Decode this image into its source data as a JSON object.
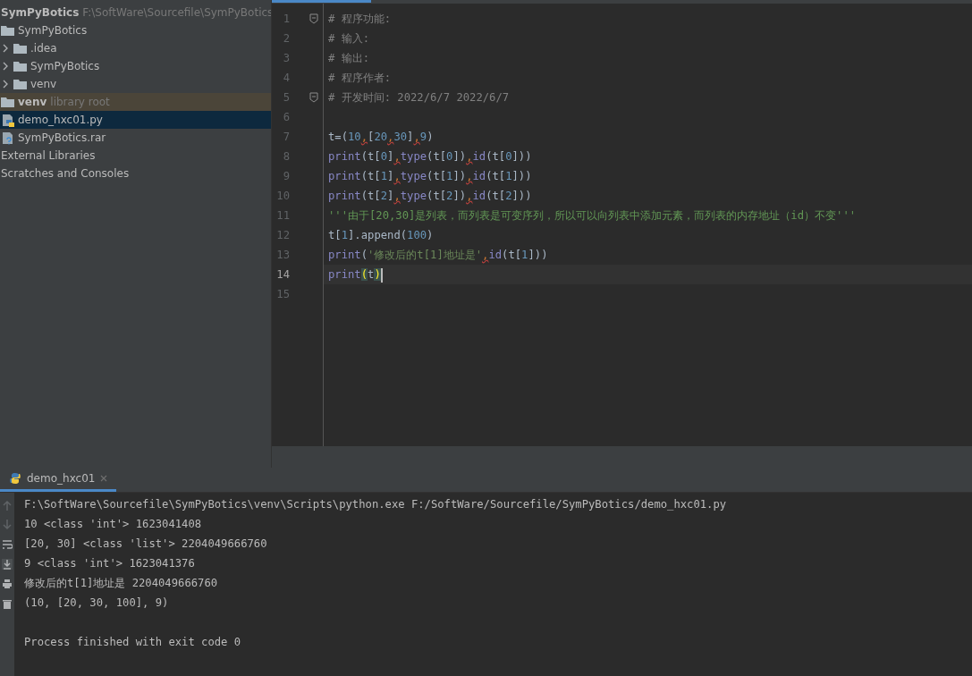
{
  "project": {
    "name": "SymPyBotics",
    "path": "F:\\SoftWare\\Sourcefile\\SymPyBotics"
  },
  "tree": [
    {
      "label": "SymPyBotics",
      "kind": "folder",
      "chevron": false,
      "selected": false,
      "highlighted": false
    },
    {
      "label": ".idea",
      "kind": "folder",
      "chevron": true,
      "selected": false,
      "highlighted": false
    },
    {
      "label": "SymPyBotics",
      "kind": "folder",
      "chevron": true,
      "selected": false,
      "highlighted": false
    },
    {
      "label": "venv",
      "kind": "folder",
      "chevron": true,
      "selected": false,
      "highlighted": false
    },
    {
      "label": "venv",
      "suffix": "library root",
      "kind": "folder",
      "chevron": false,
      "selected": false,
      "highlighted": true
    },
    {
      "label": "demo_hxc01.py",
      "kind": "python",
      "chevron": false,
      "selected": true,
      "highlighted": false
    },
    {
      "label": "SymPyBotics.rar",
      "kind": "unknown",
      "chevron": false,
      "selected": false,
      "highlighted": false
    },
    {
      "label": "External Libraries",
      "kind": "none",
      "chevron": false,
      "selected": false,
      "highlighted": false
    },
    {
      "label": "Scratches and Consoles",
      "kind": "none",
      "chevron": false,
      "selected": false,
      "highlighted": false
    }
  ],
  "editor": {
    "lines": [
      {
        "number": "1",
        "fold": true,
        "current": false,
        "segments": [
          {
            "text": "# 程序功能:",
            "kind": "comment"
          }
        ]
      },
      {
        "number": "2",
        "current": false,
        "segments": [
          {
            "text": "# 输入:",
            "kind": "comment"
          }
        ]
      },
      {
        "number": "3",
        "current": false,
        "segments": [
          {
            "text": "# 输出:",
            "kind": "comment"
          }
        ]
      },
      {
        "number": "4",
        "current": false,
        "segments": [
          {
            "text": "# 程序作者:",
            "kind": "comment"
          }
        ]
      },
      {
        "number": "5",
        "fold": true,
        "current": false,
        "segments": [
          {
            "text": "# 开发时间:  2022/6/7 2022/6/7",
            "kind": "comment"
          }
        ]
      },
      {
        "number": "6",
        "current": false
      },
      {
        "number": "7",
        "current": false,
        "segments": [
          {
            "text": "t=(",
            "kind": "plain"
          },
          {
            "text": "10",
            "kind": "number"
          },
          {
            "text": ",",
            "kind": "warn"
          },
          {
            "text": "[",
            "kind": "plain"
          },
          {
            "text": "20",
            "kind": "number"
          },
          {
            "text": ",",
            "kind": "warn"
          },
          {
            "text": "30",
            "kind": "number"
          },
          {
            "text": "]",
            "kind": "plain"
          },
          {
            "text": ",",
            "kind": "warn"
          },
          {
            "text": "9",
            "kind": "number"
          },
          {
            "text": ")",
            "kind": "plain"
          }
        ]
      },
      {
        "number": "8",
        "current": false,
        "segments": [
          {
            "text": "print",
            "kind": "builtin"
          },
          {
            "text": "(t[",
            "kind": "plain"
          },
          {
            "text": "0",
            "kind": "number"
          },
          {
            "text": "]",
            "kind": "plain"
          },
          {
            "text": ",",
            "kind": "warn"
          },
          {
            "text": "type",
            "kind": "builtin"
          },
          {
            "text": "(t[",
            "kind": "plain"
          },
          {
            "text": "0",
            "kind": "number"
          },
          {
            "text": "])",
            "kind": "plain"
          },
          {
            "text": ",",
            "kind": "warn"
          },
          {
            "text": "id",
            "kind": "builtin"
          },
          {
            "text": "(t[",
            "kind": "plain"
          },
          {
            "text": "0",
            "kind": "number"
          },
          {
            "text": "]))",
            "kind": "plain"
          }
        ]
      },
      {
        "number": "9",
        "current": false,
        "segments": [
          {
            "text": "print",
            "kind": "builtin"
          },
          {
            "text": "(t[",
            "kind": "plain"
          },
          {
            "text": "1",
            "kind": "number"
          },
          {
            "text": "]",
            "kind": "plain"
          },
          {
            "text": ",",
            "kind": "warn"
          },
          {
            "text": "type",
            "kind": "builtin"
          },
          {
            "text": "(t[",
            "kind": "plain"
          },
          {
            "text": "1",
            "kind": "number"
          },
          {
            "text": "])",
            "kind": "plain"
          },
          {
            "text": ",",
            "kind": "warn"
          },
          {
            "text": "id",
            "kind": "builtin"
          },
          {
            "text": "(t[",
            "kind": "plain"
          },
          {
            "text": "1",
            "kind": "number"
          },
          {
            "text": "]))",
            "kind": "plain"
          }
        ]
      },
      {
        "number": "10",
        "current": false,
        "segments": [
          {
            "text": "print",
            "kind": "builtin"
          },
          {
            "text": "(t[",
            "kind": "plain"
          },
          {
            "text": "2",
            "kind": "number"
          },
          {
            "text": "]",
            "kind": "plain"
          },
          {
            "text": ",",
            "kind": "warn"
          },
          {
            "text": "type",
            "kind": "builtin"
          },
          {
            "text": "(t[",
            "kind": "plain"
          },
          {
            "text": "2",
            "kind": "number"
          },
          {
            "text": "])",
            "kind": "plain"
          },
          {
            "text": ",",
            "kind": "warn"
          },
          {
            "text": "id",
            "kind": "builtin"
          },
          {
            "text": "(t[",
            "kind": "plain"
          },
          {
            "text": "2",
            "kind": "number"
          },
          {
            "text": "]))",
            "kind": "plain"
          }
        ]
      },
      {
        "number": "11",
        "current": false,
        "segments": [
          {
            "text": "'''由于[20,30]是列表，而列表是可变序列，所以可以向列表中添加元素，而列表的内存地址（id）不变'''",
            "kind": "docstring"
          }
        ]
      },
      {
        "number": "12",
        "current": false,
        "segments": [
          {
            "text": "t[",
            "kind": "plain"
          },
          {
            "text": "1",
            "kind": "number"
          },
          {
            "text": "].append(",
            "kind": "plain"
          },
          {
            "text": "100",
            "kind": "number"
          },
          {
            "text": ")",
            "kind": "plain"
          }
        ]
      },
      {
        "number": "13",
        "current": false,
        "segments": [
          {
            "text": "print",
            "kind": "builtin"
          },
          {
            "text": "(",
            "kind": "plain"
          },
          {
            "text": "'修改后的t[1]地址是'",
            "kind": "string"
          },
          {
            "text": ",",
            "kind": "warn"
          },
          {
            "text": "id",
            "kind": "builtin"
          },
          {
            "text": "(t[",
            "kind": "plain"
          },
          {
            "text": "1",
            "kind": "number"
          },
          {
            "text": "]))",
            "kind": "plain"
          }
        ]
      },
      {
        "number": "14",
        "current": true,
        "segments": [
          {
            "text": "print",
            "kind": "builtin"
          },
          {
            "text": "(",
            "kind": "brace"
          },
          {
            "text": "t",
            "kind": "plain"
          },
          {
            "text": ")",
            "kind": "brace"
          }
        ]
      },
      {
        "number": "15",
        "current": false
      }
    ]
  },
  "run_panel": {
    "tab": {
      "title": "demo_hxc01",
      "selected": true
    },
    "output": [
      "F:\\SoftWare\\Sourcefile\\SymPyBotics\\venv\\Scripts\\python.exe F:/SoftWare/Sourcefile/SymPyBotics/demo_hxc01.py",
      "10 <class 'int'> 1623041408",
      "[20, 30] <class 'list'> 2204049666760",
      "9 <class 'int'> 1623041376",
      "修改后的t[1]地址是 2204049666760",
      "(10, [20, 30, 100], 9)"
    ],
    "exit_message": "Process finished with exit code 0"
  }
}
